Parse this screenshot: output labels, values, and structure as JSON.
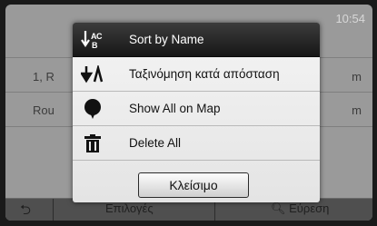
{
  "status": {
    "clock": "10:54"
  },
  "background": {
    "rows": [
      {
        "label": "1, R",
        "suffix": "m"
      },
      {
        "label": "Rou",
        "suffix": "m"
      }
    ],
    "bottom_bar": {
      "back_icon": "back-arrow-icon",
      "options_label": "Επιλογές",
      "search_label": "Εύρεση",
      "search_icon": "search-icon"
    }
  },
  "menu": {
    "items": [
      {
        "label": "Sort by Name",
        "icon": "sort-alpha-icon",
        "selected": true
      },
      {
        "label": "Ταξινόμηση κατά απόσταση",
        "icon": "sort-distance-icon",
        "selected": false
      },
      {
        "label": "Show All on Map",
        "icon": "map-pin-icon",
        "selected": false
      },
      {
        "label": "Delete All",
        "icon": "trash-icon",
        "selected": false
      }
    ],
    "close_label": "Κλείσιμο"
  },
  "colors": {
    "selected_bg": "#1f1f1f",
    "menu_bg": "#ececec",
    "dim_bg": "#9a9a9a"
  }
}
